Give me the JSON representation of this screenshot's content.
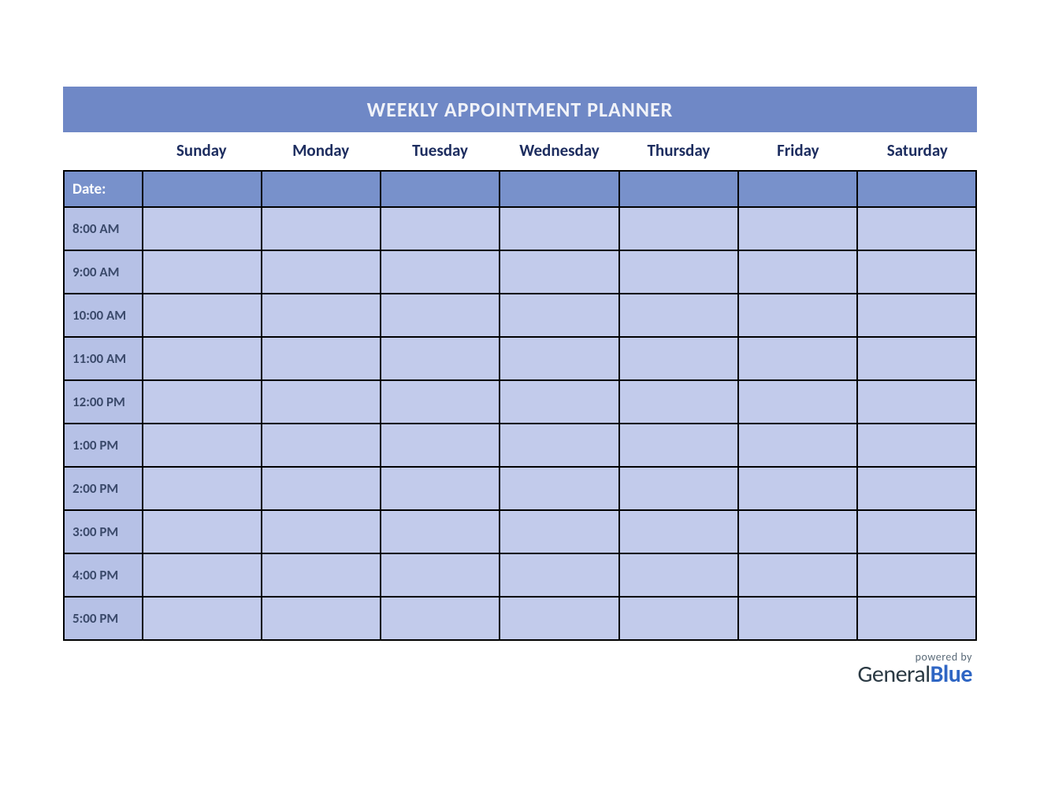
{
  "title": "WEEKLY APPOINTMENT PLANNER",
  "days": [
    "Sunday",
    "Monday",
    "Tuesday",
    "Wednesday",
    "Thursday",
    "Friday",
    "Saturday"
  ],
  "date_label": "Date:",
  "times": [
    "8:00 AM",
    "9:00 AM",
    "10:00 AM",
    "11:00 AM",
    "12:00 PM",
    "1:00 PM",
    "2:00 PM",
    "3:00 PM",
    "4:00 PM",
    "5:00 PM"
  ],
  "footer": {
    "powered": "powered by",
    "brand_general": "General",
    "brand_blue": "Blue"
  }
}
